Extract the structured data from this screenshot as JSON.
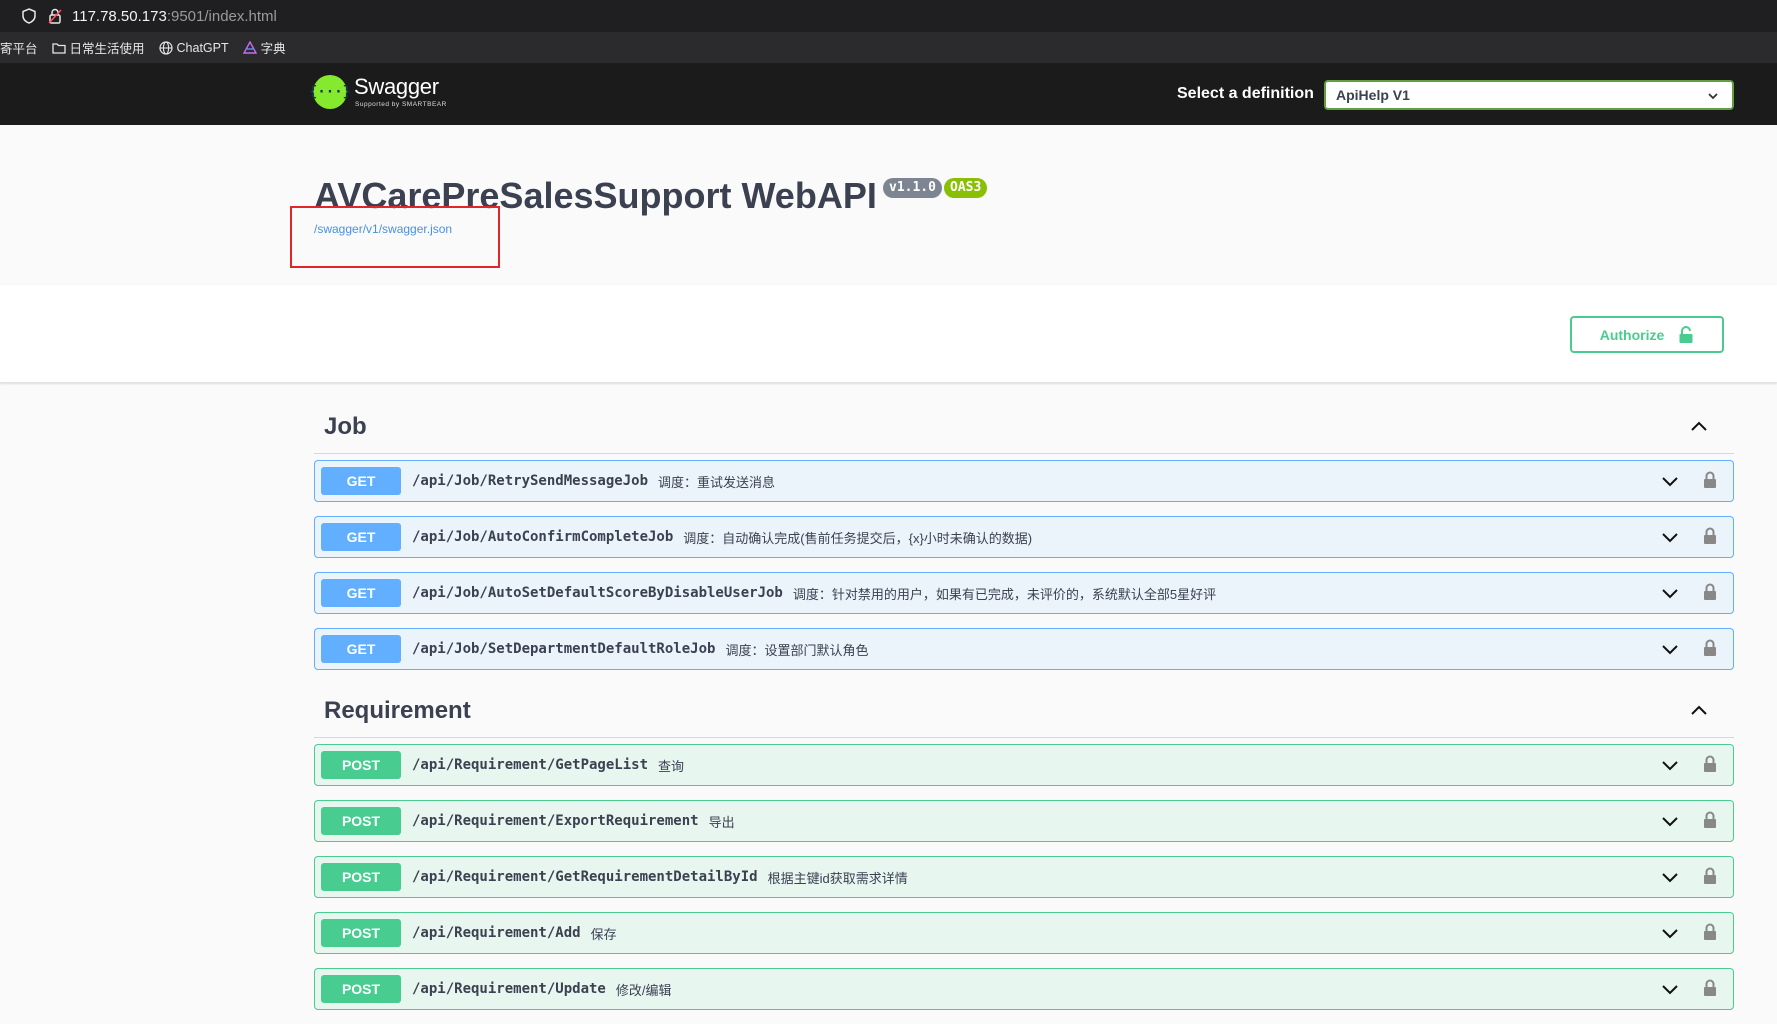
{
  "browser": {
    "url_host": "117.78.50.173",
    "url_path": ":9501/index.html",
    "bookmarks": [
      {
        "label": "寄平台",
        "icon": "none"
      },
      {
        "label": "日常生活使用",
        "icon": "folder-icon"
      },
      {
        "label": "ChatGPT",
        "icon": "globe-icon"
      },
      {
        "label": "字典",
        "icon": "triangle-icon"
      }
    ]
  },
  "topbar": {
    "logo_name": "Swagger",
    "logo_sub": "Supported by SMARTBEAR",
    "logo_glyph": "{···}",
    "definition_label": "Select a definition",
    "definition_value": "ApiHelp V1"
  },
  "info": {
    "title": "AVCarePreSalesSupport WebAPI",
    "version_badge": "v1.1.0",
    "oas_badge": "OAS3",
    "spec_link": "/swagger/v1/swagger.json"
  },
  "authorize_label": "Authorize",
  "tags": [
    {
      "name": "Job",
      "operations": [
        {
          "method": "GET",
          "path": "/api/Job/RetrySendMessageJob",
          "summary": "调度：重试发送消息"
        },
        {
          "method": "GET",
          "path": "/api/Job/AutoConfirmCompleteJob",
          "summary": "调度：自动确认完成(售前任务提交后，{x}小时未确认的数据)"
        },
        {
          "method": "GET",
          "path": "/api/Job/AutoSetDefaultScoreByDisableUserJob",
          "summary": "调度：针对禁用的用户，如果有已完成，未评价的，系统默认全部5星好评"
        },
        {
          "method": "GET",
          "path": "/api/Job/SetDepartmentDefaultRoleJob",
          "summary": "调度：设置部门默认角色"
        }
      ]
    },
    {
      "name": "Requirement",
      "operations": [
        {
          "method": "POST",
          "path": "/api/Requirement/GetPageList",
          "summary": "查询"
        },
        {
          "method": "POST",
          "path": "/api/Requirement/ExportRequirement",
          "summary": "导出"
        },
        {
          "method": "POST",
          "path": "/api/Requirement/GetRequirementDetailById",
          "summary": "根据主键id获取需求详情"
        },
        {
          "method": "POST",
          "path": "/api/Requirement/Add",
          "summary": "保存"
        },
        {
          "method": "POST",
          "path": "/api/Requirement/Update",
          "summary": "修改/编辑"
        }
      ]
    }
  ],
  "colors": {
    "get": "#61affe",
    "post": "#49cc90",
    "brand": "#85ea2d",
    "highlight": "#e0252b"
  }
}
